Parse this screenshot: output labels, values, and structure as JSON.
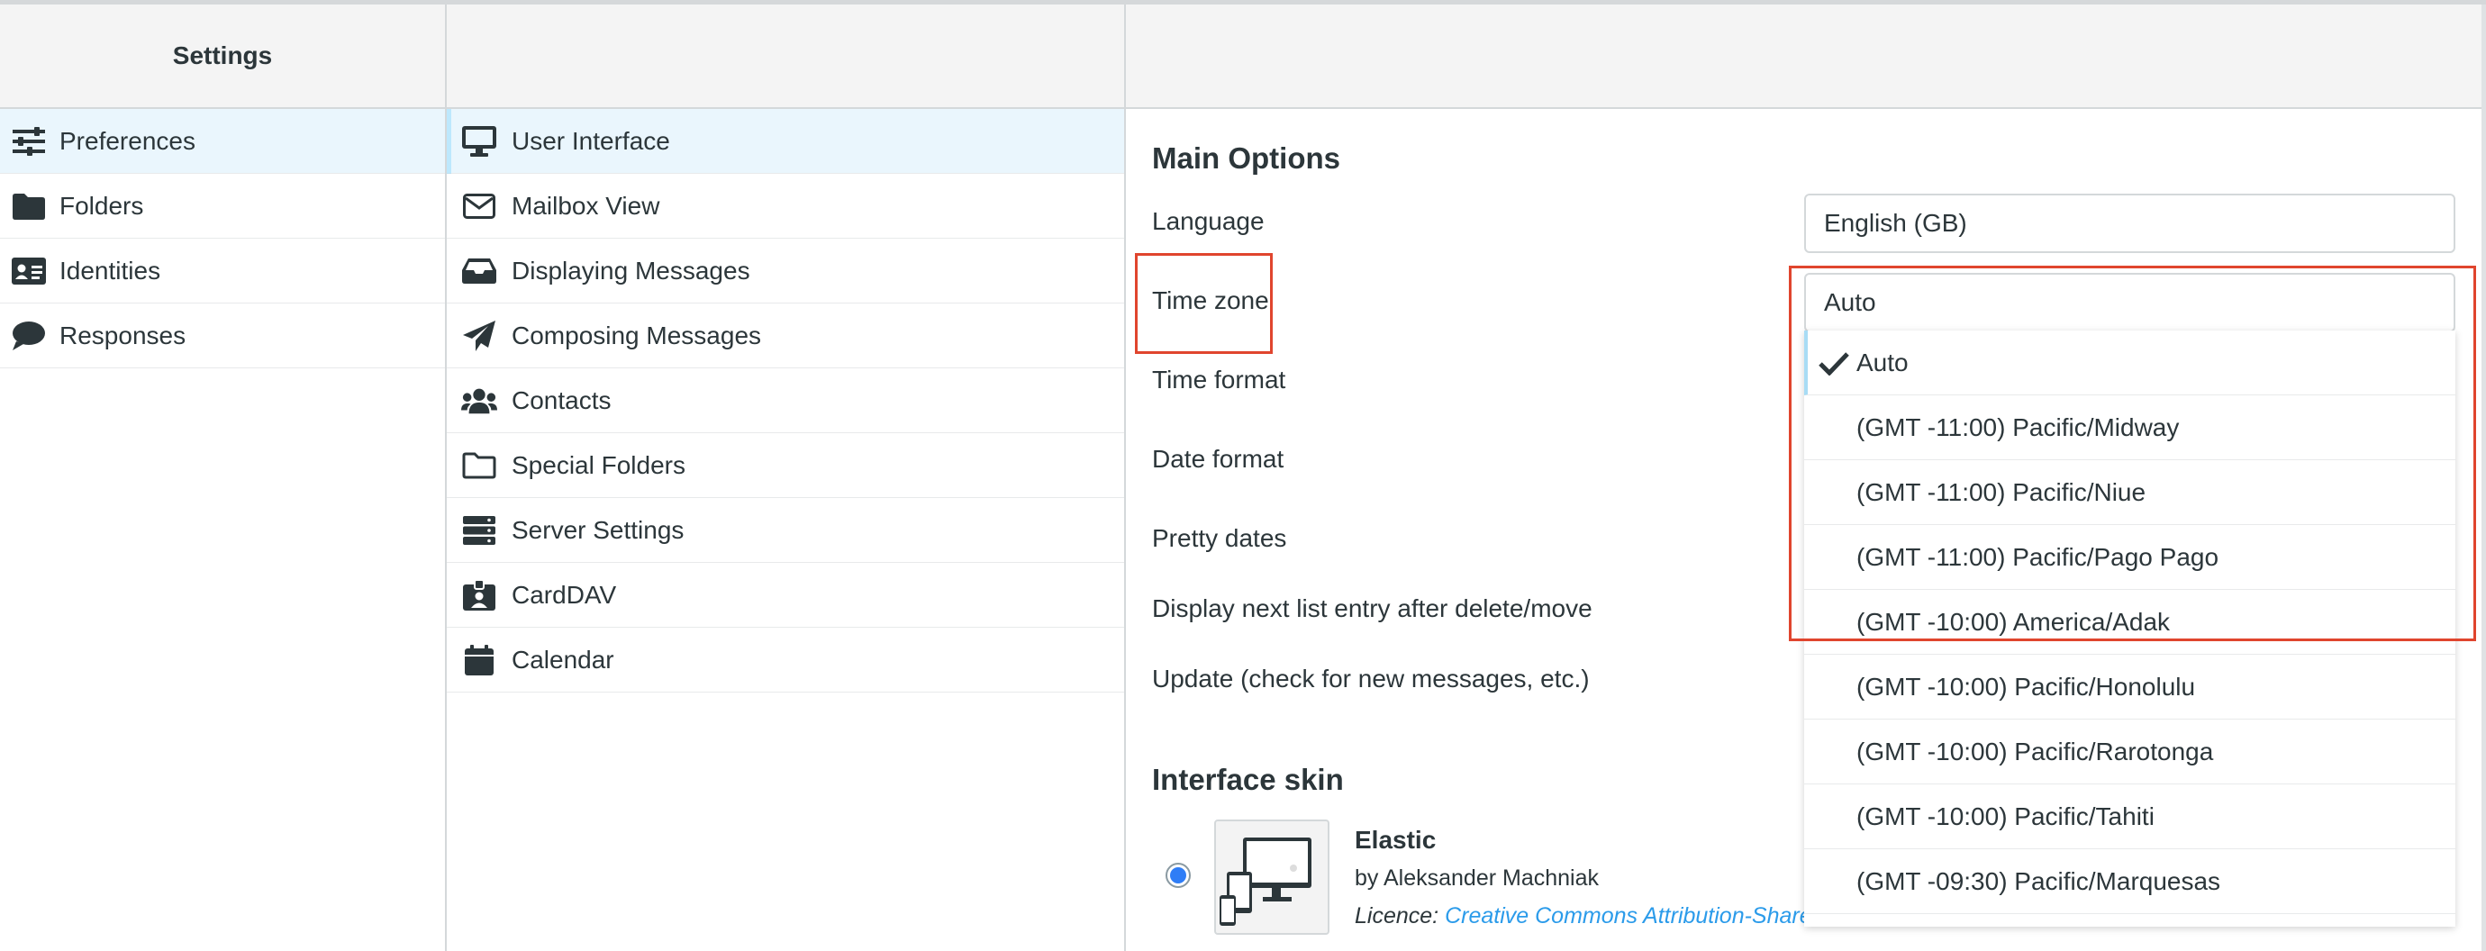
{
  "settings_nav": {
    "title": "Settings",
    "items": [
      {
        "label": "Preferences",
        "icon": "sliders-icon"
      },
      {
        "label": "Folders",
        "icon": "folder-icon"
      },
      {
        "label": "Identities",
        "icon": "id-card-icon"
      },
      {
        "label": "Responses",
        "icon": "comment-icon"
      }
    ]
  },
  "sections": [
    {
      "label": "User Interface",
      "icon": "desktop-icon"
    },
    {
      "label": "Mailbox View",
      "icon": "envelope-icon"
    },
    {
      "label": "Displaying Messages",
      "icon": "inbox-icon"
    },
    {
      "label": "Composing Messages",
      "icon": "paper-plane-icon"
    },
    {
      "label": "Contacts",
      "icon": "users-icon"
    },
    {
      "label": "Special Folders",
      "icon": "folder-outline-icon"
    },
    {
      "label": "Server Settings",
      "icon": "server-icon"
    },
    {
      "label": "CardDAV",
      "icon": "badge-icon"
    },
    {
      "label": "Calendar",
      "icon": "calendar-icon"
    }
  ],
  "main_options": {
    "title": "Main Options",
    "language_label": "Language",
    "language_value": "English (GB)",
    "timezone_label": "Time zone",
    "timezone_value": "Auto",
    "time_format_label": "Time format",
    "date_format_label": "Date format",
    "pretty_dates_label": "Pretty dates",
    "display_next_label": "Display next list entry after delete/move",
    "update_label": "Update (check for new messages, etc.)"
  },
  "timezone_options": [
    "Auto",
    "(GMT -11:00) Pacific/Midway",
    "(GMT -11:00) Pacific/Niue",
    "(GMT -11:00) Pacific/Pago Pago",
    "(GMT -10:00) America/Adak",
    "(GMT -10:00) Pacific/Honolulu",
    "(GMT -10:00) Pacific/Rarotonga",
    "(GMT -10:00) Pacific/Tahiti",
    "(GMT -09:30) Pacific/Marquesas"
  ],
  "interface_skin": {
    "title": "Interface skin",
    "name": "Elastic",
    "author": "by Aleksander Machniak",
    "licence_label": "Licence:",
    "licence_link": "Creative Commons Attribution-Share"
  },
  "colors": {
    "accent": "#37beff",
    "selected_bg": "#eaf6fd",
    "highlight_border": "#e0452e",
    "link": "#2b9bea"
  }
}
